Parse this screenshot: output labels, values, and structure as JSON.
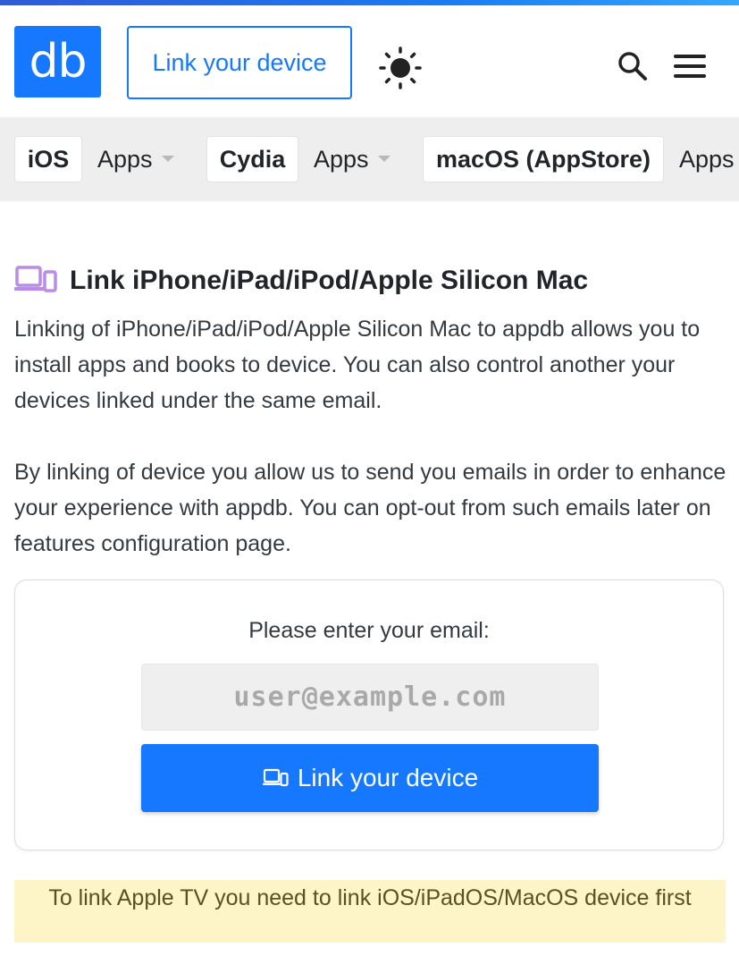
{
  "header": {
    "logo_text": "db",
    "link_device_label": "Link your device",
    "theme_icon": "sun-icon",
    "search_icon": "search-icon",
    "menu_icon": "hamburger-menu-icon"
  },
  "nav": {
    "items": [
      {
        "pill": "iOS",
        "dropdown": "Apps"
      },
      {
        "pill": "Cydia",
        "dropdown": "Apps"
      },
      {
        "pill": "macOS (AppStore)",
        "dropdown": "Apps"
      }
    ]
  },
  "main": {
    "title": "Link iPhone/iPad/iPod/Apple Silicon Mac",
    "title_icon": "devices-icon",
    "paragraph_1": "Linking of iPhone/iPad/iPod/Apple Silicon Mac to appdb allows you to install apps and books to device. You can also control another your devices linked under the same email.",
    "paragraph_2": "By linking of device you allow us to send you emails in order to enhance your experience with appdb. You can opt-out from such emails later on features configuration page.",
    "form": {
      "label": "Please enter your email:",
      "email_placeholder": "user@example.com",
      "email_value": "",
      "submit_label": "Link your device",
      "submit_icon": "devices-icon"
    },
    "notice": "To link Apple TV you need to link iOS/iPadOS/MacOS device first"
  },
  "colors": {
    "primary": "#1677ff",
    "nav_background": "#eeeeee",
    "notice_background": "#fdf4c8",
    "title_icon_color": "#b98ce8"
  }
}
